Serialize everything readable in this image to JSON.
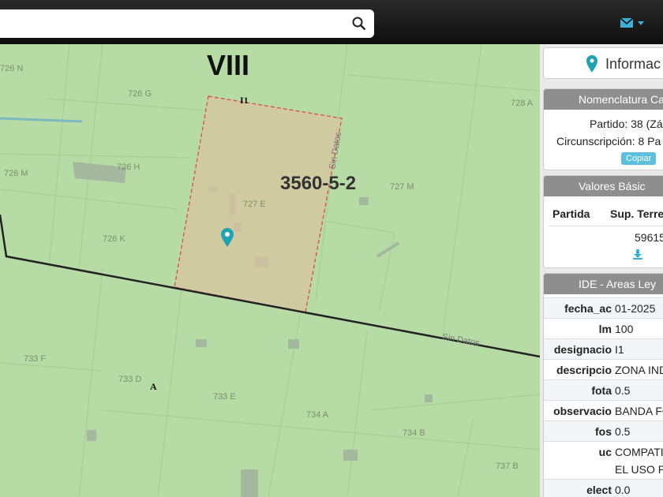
{
  "search": {
    "placeholder": ""
  },
  "map": {
    "sector_label": "VIII",
    "parcel_label": "3560-5-2",
    "zone_label": "I1",
    "zone_label_A": "A",
    "road_labels": [
      "Sin Datos",
      "Sin Datos"
    ],
    "parcel_codes": [
      "726 N",
      "726 G",
      "728 A",
      "726 M",
      "726 H",
      "727 E",
      "727 M",
      "726 K",
      "733 F",
      "733 D",
      "733 E",
      "734 A",
      "734 B",
      "737 B"
    ],
    "colors": {
      "land": "#b7dba4",
      "parcel_fill": "#d8c4a0",
      "parcel_border": "#d9534f",
      "marker": "#1fa3b3"
    }
  },
  "panel": {
    "title": "Informac",
    "nomenclatura": {
      "header": "Nomenclatura Ca",
      "partido": "Partido: 38 (Zá",
      "circunscripcion": "Circunscripción: 8 Pa",
      "copy_button": "Copiar"
    },
    "valores": {
      "header": "Valores Básic",
      "col1": "Partida",
      "col2": "Sup. Terre",
      "value": "59615"
    },
    "ide": {
      "header": "IDE - Areas Ley",
      "rows": [
        {
          "k": "fecha_ac",
          "v": "01-2025"
        },
        {
          "k": "lm",
          "v": "100"
        },
        {
          "k": "designacio",
          "v": "I1"
        },
        {
          "k": "descripcio",
          "v": "ZONA IND"
        },
        {
          "k": "fota",
          "v": "0.5"
        },
        {
          "k": "observacio",
          "v": "BANDA FO"
        },
        {
          "k": "fos",
          "v": "0.5"
        },
        {
          "k": "uc",
          "v": "COMPATI",
          "v2": "EL USO P"
        },
        {
          "k": "elect",
          "v": "0.0"
        }
      ]
    }
  }
}
